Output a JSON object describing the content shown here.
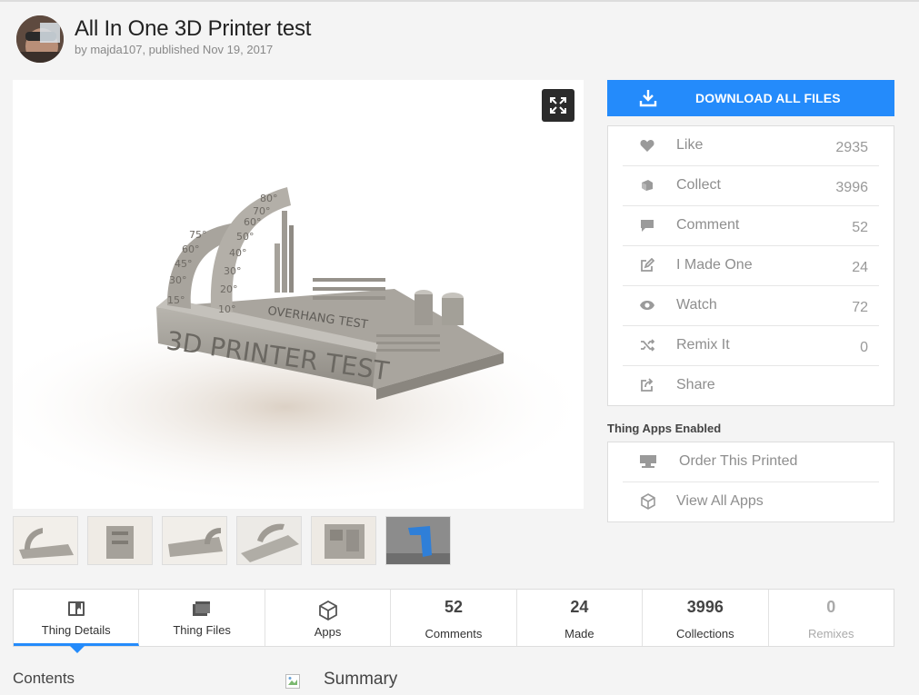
{
  "thing": {
    "title": "All In One 3D Printer test",
    "byline": "by majda107, published Nov 19, 2017"
  },
  "render": {
    "arc_large_labels": [
      "80°",
      "70°",
      "60°",
      "50°",
      "40°",
      "30°",
      "20°",
      "10°"
    ],
    "arc_small_labels": [
      "75°",
      "60°",
      "45°",
      "30°",
      "15°"
    ],
    "overhang_text": "OVERHANG TEST",
    "base_text": "3D PRINTER TEST"
  },
  "download": {
    "label": "DOWNLOAD ALL FILES",
    "icon": "download-icon"
  },
  "actions": [
    {
      "label": "Like",
      "count": "2935",
      "icon": "heart-icon"
    },
    {
      "label": "Collect",
      "count": "3996",
      "icon": "collect-icon"
    },
    {
      "label": "Comment",
      "count": "52",
      "icon": "comment-icon"
    },
    {
      "label": "I Made One",
      "count": "24",
      "icon": "edit-icon"
    },
    {
      "label": "Watch",
      "count": "72",
      "icon": "eye-icon"
    },
    {
      "label": "Remix It",
      "count": "0",
      "icon": "shuffle-icon"
    },
    {
      "label": "Share",
      "count": "",
      "icon": "share-icon"
    }
  ],
  "apps": {
    "title": "Thing Apps Enabled",
    "items": [
      {
        "label": "Order This Printed",
        "icon": "printer-icon"
      },
      {
        "label": "View All Apps",
        "icon": "cube-icon"
      }
    ]
  },
  "tabs": [
    {
      "label": "Thing Details",
      "number": "",
      "icon": "details-icon"
    },
    {
      "label": "Thing Files",
      "number": "",
      "icon": "files-icon"
    },
    {
      "label": "Apps",
      "number": "",
      "icon": "cube-icon"
    },
    {
      "label": "Comments",
      "number": "52"
    },
    {
      "label": "Made",
      "number": "24"
    },
    {
      "label": "Collections",
      "number": "3996"
    },
    {
      "label": "Remixes",
      "number": "0"
    }
  ],
  "sections": {
    "contents": "Contents",
    "summary": "Summary"
  },
  "colors": {
    "accent": "#248bfb",
    "icon_gray": "#9a9a9a",
    "background": "#f4f4f4"
  }
}
